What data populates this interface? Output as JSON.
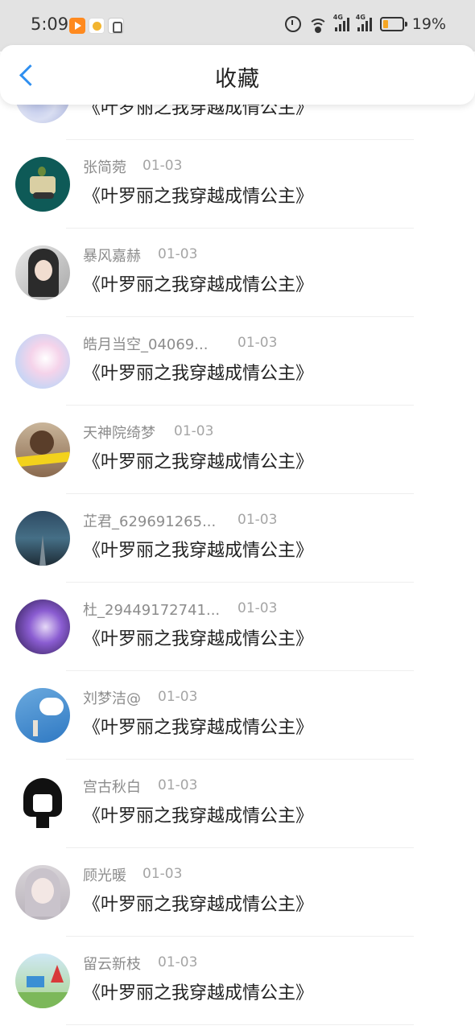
{
  "status_bar": {
    "time": "5:09",
    "battery": "19%"
  },
  "header": {
    "title": "收藏"
  },
  "items": [
    {
      "name": "",
      "date": "",
      "book": "《叶罗丽之我穿越成情公主》"
    },
    {
      "name": "张简菀",
      "date": "01-03",
      "book": "《叶罗丽之我穿越成情公主》"
    },
    {
      "name": "暴风嘉赫",
      "date": "01-03",
      "book": "《叶罗丽之我穿越成情公主》"
    },
    {
      "name": "皓月当空_04069...",
      "date": "01-03",
      "book": "《叶罗丽之我穿越成情公主》"
    },
    {
      "name": "天神院绮梦",
      "date": "01-03",
      "book": "《叶罗丽之我穿越成情公主》"
    },
    {
      "name": "芷君_629691265...",
      "date": "01-03",
      "book": "《叶罗丽之我穿越成情公主》"
    },
    {
      "name": "杜_29449172741...",
      "date": "01-03",
      "book": "《叶罗丽之我穿越成情公主》"
    },
    {
      "name": "刘梦洁@",
      "date": "01-03",
      "book": "《叶罗丽之我穿越成情公主》"
    },
    {
      "name": "宫古秋白",
      "date": "01-03",
      "book": "《叶罗丽之我穿越成情公主》"
    },
    {
      "name": "顾光暖",
      "date": "01-03",
      "book": "《叶罗丽之我穿越成情公主》"
    },
    {
      "name": "留云新枝",
      "date": "01-03",
      "book": "《叶罗丽之我穿越成情公主》"
    }
  ]
}
